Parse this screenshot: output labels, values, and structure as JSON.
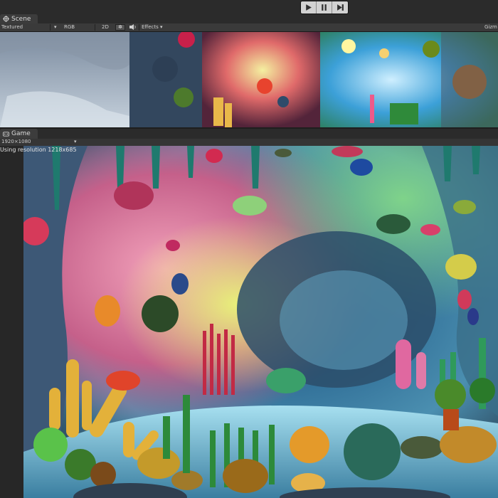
{
  "playbar": {
    "play_icon": "play-icon",
    "pause_icon": "pause-icon",
    "step_icon": "step-icon"
  },
  "scene": {
    "tab_label": "Scene",
    "tab_icon": "scene-icon",
    "toolbar": {
      "draw_mode": "Textured",
      "render_mode": "RGB",
      "mode_2d": "2D",
      "light_icon": "sun-icon",
      "audio_icon": "speaker-icon",
      "effects_label": "Effects",
      "gizmos_label": "Gizm"
    }
  },
  "game": {
    "tab_label": "Game",
    "tab_icon": "game-icon",
    "aspect_label": "1920×1080",
    "resolution_note": "Using resolution 1218x685"
  },
  "colors": {
    "editor_bg": "#1e1e1e",
    "panel_header": "#2b2b2b",
    "toolbar": "#3a3a3a",
    "tab_active": "#3c3c3c"
  }
}
